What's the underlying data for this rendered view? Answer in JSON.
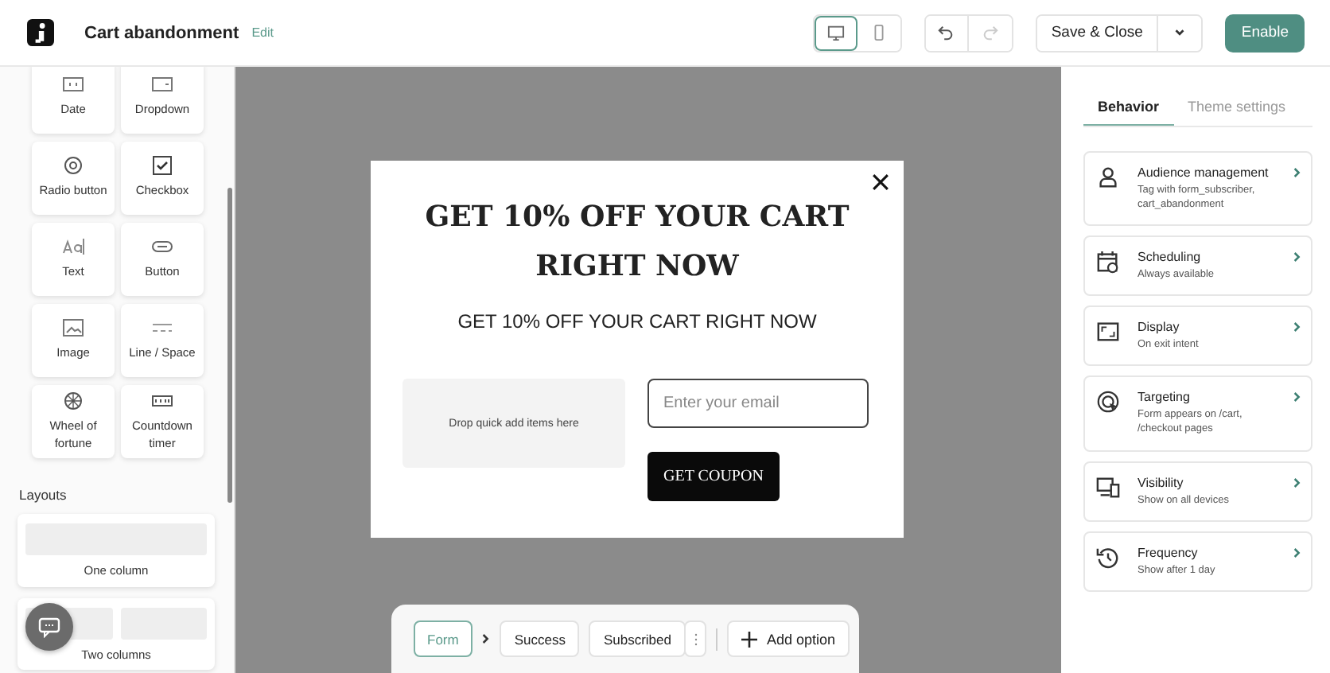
{
  "header": {
    "title": "Cart abandonment",
    "edit_link": "Edit",
    "devices": [
      {
        "kind": "desktop",
        "selected": true
      },
      {
        "kind": "mobile",
        "selected": false
      }
    ],
    "history": [
      {
        "kind": "undo",
        "disabled": false
      },
      {
        "kind": "redo",
        "disabled": true
      }
    ],
    "save_button": "Save & Close",
    "enable_button": "Enable"
  },
  "sidebar": {
    "blocks": [
      {
        "label": "Date",
        "kind": "date"
      },
      {
        "label": "Dropdown",
        "kind": "dropdown"
      },
      {
        "label": "Radio button",
        "kind": "radio"
      },
      {
        "label": "Checkbox",
        "kind": "checkbox"
      },
      {
        "label": "Text",
        "kind": "text"
      },
      {
        "label": "Button",
        "kind": "button"
      },
      {
        "label": "Image",
        "kind": "image"
      },
      {
        "label": "Line / Space",
        "kind": "line"
      },
      {
        "label": "Wheel of fortune",
        "kind": "wheel"
      },
      {
        "label": "Countdown timer",
        "kind": "timer"
      }
    ],
    "layouts_heading": "Layouts",
    "layouts": [
      {
        "label": "One column",
        "kind": "single"
      },
      {
        "label": "Two columns",
        "kind": "double"
      }
    ]
  },
  "popup": {
    "headline": "GET 10% OFF YOUR CART RIGHT NOW",
    "subheadline": "GET 10% OFF YOUR CART RIGHT NOW",
    "drop_zone": "Drop quick add items here",
    "email_placeholder": "Enter your email",
    "coupon_button": "GET COUPON"
  },
  "steps": [
    {
      "label": "Form",
      "selected": true
    },
    {
      "label": "Success",
      "selected": false
    },
    {
      "label": "Subscribed",
      "selected": false
    }
  ],
  "add_option": "Add option",
  "panel": {
    "tabs": [
      {
        "label": "Behavior",
        "selected": true
      },
      {
        "label": "Theme settings",
        "selected": false
      }
    ],
    "settings": [
      {
        "kind": "audience",
        "title": "Audience management",
        "description": "Tag with form_subscriber, cart_abandonment"
      },
      {
        "kind": "scheduling",
        "title": "Scheduling",
        "description": "Always available"
      },
      {
        "kind": "display",
        "title": "Display",
        "description": "On exit intent"
      },
      {
        "kind": "targeting",
        "title": "Targeting",
        "description": "Form appears on /cart, /checkout pages"
      },
      {
        "kind": "visibility",
        "title": "Visibility",
        "description": "Show on all devices"
      },
      {
        "kind": "frequency",
        "title": "Frequency",
        "description": "Show after 1 day"
      }
    ]
  }
}
